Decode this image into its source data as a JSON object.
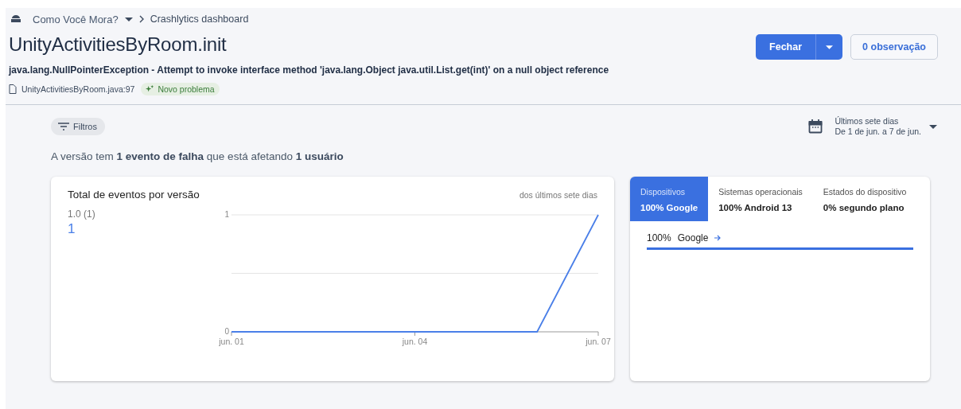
{
  "breadcrumb": {
    "app": "Como Você Mora?",
    "page": "Crashlytics dashboard"
  },
  "issue": {
    "title": "UnityActivitiesByRoom.init",
    "exception": "java.lang.NullPointerException - Attempt to invoke interface method 'java.lang.Object java.util.List.get(int)' on a null object reference",
    "file": "UnityActivitiesByRoom.java:97",
    "badge": "Novo problema"
  },
  "actions": {
    "close": "Fechar",
    "notes": "0 observação"
  },
  "filters": {
    "label": "Filtros"
  },
  "date_range": {
    "title": "Últimos sete dias",
    "range": "De 1 de jun. a 7 de jun."
  },
  "summary": "A versão tem **1 evento de falha** que está afetando **1 usuário**",
  "events_card": {
    "title": "Total de eventos por versão",
    "period": "dos últimos sete dias",
    "count": "1",
    "chart_data": {
      "type": "line",
      "categories": [
        "jun. 01",
        null,
        null,
        "jun. 04",
        null,
        null,
        "jun. 07"
      ],
      "series": [
        {
          "name": "1.0 (1)",
          "color": "#4a7fe8",
          "values": [
            0,
            0,
            0,
            0,
            0,
            0,
            1
          ]
        }
      ],
      "ylim": [
        0,
        1
      ],
      "yticks": [
        0,
        1
      ],
      "ref_lines": [
        {
          "axis": "y",
          "value": 0.5
        }
      ]
    }
  },
  "breakdown_card": {
    "tabs": [
      {
        "label": "Dispositivos",
        "value": "100% Google",
        "selected": true
      },
      {
        "label": "Sistemas operacionais",
        "value": "100% Android 13",
        "selected": false
      },
      {
        "label": "Estados do dispositivo",
        "value": "0% segundo plano",
        "selected": false
      }
    ],
    "rows": [
      {
        "percent": "100%",
        "name": "Google",
        "level": 1
      }
    ]
  }
}
